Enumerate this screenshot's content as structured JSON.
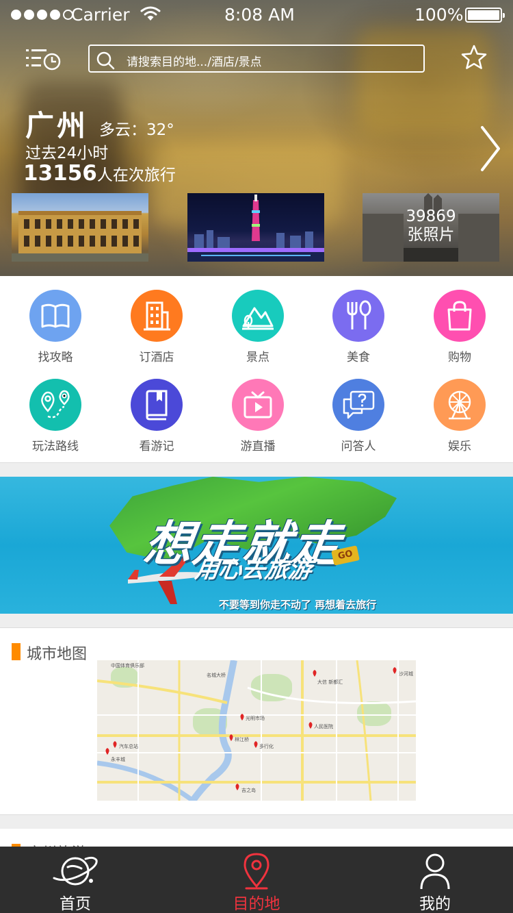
{
  "status_bar": {
    "carrier": "Carrier",
    "time": "8:08 AM",
    "battery": "100%"
  },
  "header": {
    "search_placeholder": "请搜索目的地.../酒店/景点",
    "icons": [
      "history-list-icon",
      "search-icon",
      "star-icon"
    ]
  },
  "city": {
    "name": "广州",
    "weather": "多云：32°",
    "past_label": "过去24小时",
    "traveler_count": "13156",
    "traveler_text": "人在次旅行",
    "photo_count": "39869",
    "photo_label": "张照片"
  },
  "categories": [
    {
      "label": "找攻略",
      "color": "#6ea3f0",
      "icon": "book-icon"
    },
    {
      "label": "订酒店",
      "color": "#ff7a1f",
      "icon": "hotel-icon"
    },
    {
      "label": "景点",
      "color": "#18cbbd",
      "icon": "mountain-icon"
    },
    {
      "label": "美食",
      "color": "#7b6cf0",
      "icon": "fork-spoon-icon"
    },
    {
      "label": "购物",
      "color": "#ff4fb0",
      "icon": "shopping-bag-icon"
    },
    {
      "label": "玩法路线",
      "color": "#13bfae",
      "icon": "route-pin-icon"
    },
    {
      "label": "看游记",
      "color": "#4b49d8",
      "icon": "journal-icon"
    },
    {
      "label": "游直播",
      "color": "#ff78b7",
      "icon": "tv-play-icon"
    },
    {
      "label": "问答人",
      "color": "#4f7fe0",
      "icon": "question-bubble-icon"
    },
    {
      "label": "娱乐",
      "color": "#ff9a55",
      "icon": "ferris-wheel-icon"
    }
  ],
  "banner": {
    "headline": "想走就走",
    "subline": "用心去旅游",
    "tagline": "不要等到你走不动了 再想着去旅行",
    "sign": "GO"
  },
  "map_section": {
    "title": "城市地图",
    "places": [
      "大信 新都汇",
      "沙河城",
      "光明市场",
      "人民医院",
      "林江桥",
      "多行化",
      "永丰城",
      "汽车总站",
      "吉之岛",
      "中国体育俱乐部",
      "名城大桥"
    ]
  },
  "next_section": {
    "title": "广州旅游"
  },
  "tabbar": [
    {
      "label": "首页",
      "icon": "planet-icon",
      "active": false
    },
    {
      "label": "目的地",
      "icon": "location-pin-icon",
      "active": true
    },
    {
      "label": "我的",
      "icon": "user-icon",
      "active": false
    }
  ],
  "colors": {
    "accent": "#f0333e",
    "section_marker": "#ff8b00",
    "tabbar_bg": "#2e2e2e"
  }
}
